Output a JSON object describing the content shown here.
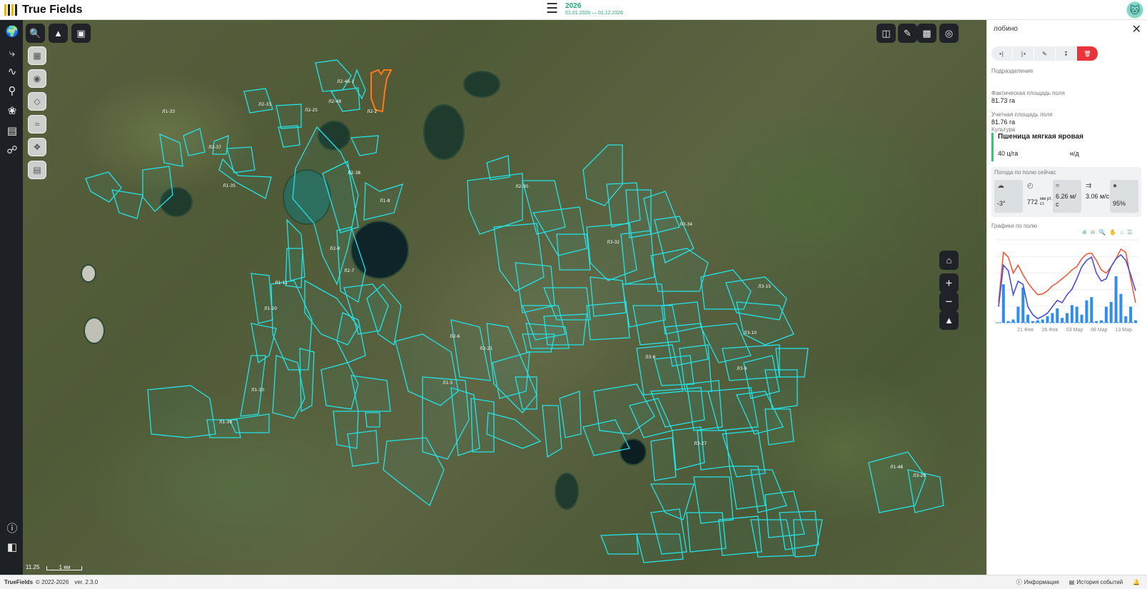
{
  "app": {
    "name": "True Fields",
    "logo_colors": [
      "#f4b400",
      "#222222",
      "#f4b400",
      "#222222"
    ]
  },
  "header": {
    "menu_icon": "hamburger-icon",
    "year": "2026",
    "date_range": "01.01.2026 — 01.12.2026",
    "user_avatar_icon": "cat-avatar-icon"
  },
  "sidebar": {
    "top_items": [
      "globe-leaf-icon",
      "tractor-route-icon",
      "trend-chart-icon",
      "analysis-search-icon",
      "plant-hand-icon",
      "calendar-list-icon",
      "network-icon"
    ],
    "bottom_items": [
      "info-icon",
      "panel-toggle-icon"
    ]
  },
  "map": {
    "toolbar_left": [
      "search-icon",
      "terrain-icon",
      "crop-select-icon"
    ],
    "layer_tools": [
      "map-layers-icon",
      "pin-icon",
      "stack-icon",
      "ruler-tool-icon",
      "shapes-icon",
      "report-icon"
    ],
    "toolbar_right": [
      "compare-icon",
      "measure-icon",
      "hatch-icon",
      "locate-icon"
    ],
    "zoom_controls": [
      "home-icon",
      "zoom-in-icon",
      "zoom-out-icon",
      "north-arrow-icon"
    ],
    "field_color": "#23e3e8",
    "selected_field_color": "#ff7a1a",
    "scale_zoom": "11.25",
    "scale_label": "1 км",
    "field_labels": [
      "Л2-46-1",
      "Л2-48",
      "Л2-25",
      "Л1-33",
      "Л2-37",
      "Л1-35",
      "Л2-33",
      "Л1-11",
      "Л1-8",
      "Л3-32",
      "Л2-30",
      "Л1-20",
      "Л2-38",
      "Л2-2",
      "Л2-7",
      "Л1-5",
      "Л2-21",
      "Л3-8",
      "Л3-27",
      "Л3-10",
      "Л1-48",
      "Л1-39",
      "Л3-9",
      "Л2-8",
      "Л3-15",
      "Л1-10",
      "Л2-6",
      "Л3-34",
      "Л3-29"
    ]
  },
  "panel": {
    "title": "лобино",
    "close_icon": "close-icon",
    "actions": [
      "split-field-icon",
      "merge-field-icon",
      "edit-icon",
      "download-icon",
      "delete-icon"
    ],
    "subdivision_label": "Подразделение",
    "actual_area_label": "Фактическая площадь поля",
    "actual_area_value": "81.73 га",
    "registered_area_label": "Учетная площадь поля",
    "registered_area_value": "81.76 га",
    "crop_label": "Культура",
    "crop_name": "Пшеница мягкая яровая",
    "crop_yield": "40 ц/га",
    "crop_extra": "н/д",
    "weather_title": "Погода по полю сейчас",
    "weather": {
      "temp": "-3°",
      "pressure_value": "772",
      "pressure_unit": "мм рт. ст.",
      "wind_gust": "6.26 м/с",
      "wind": "3.06 м/с",
      "humidity": "95%"
    },
    "charts_title": "Графики по полю",
    "chart_tools": [
      "zoom-in-icon",
      "zoom-out-icon",
      "magnify-icon",
      "pan-icon",
      "home-icon",
      "menu-icon"
    ]
  },
  "chart_data": {
    "type": "line",
    "xlabel": "",
    "ylabel": "",
    "x_ticks": [
      "21 Фев",
      "26 Фев",
      "03 Мар",
      "08 Мар",
      "13 Мар"
    ],
    "series": [
      {
        "color": "#ef5a3c",
        "values": [
          0.25,
          0.88,
          0.82,
          0.62,
          0.72,
          0.6,
          0.5,
          0.42,
          0.35,
          0.36,
          0.4,
          0.46,
          0.5,
          0.55,
          0.6,
          0.66,
          0.7,
          0.8,
          0.86,
          0.87,
          0.78,
          0.66,
          0.62,
          0.7,
          0.8,
          0.92,
          0.88,
          0.55,
          0.25
        ]
      },
      {
        "color": "#4b4fd6",
        "values": [
          0.2,
          0.72,
          0.65,
          0.35,
          0.52,
          0.48,
          0.2,
          0.1,
          0.05,
          0.08,
          0.12,
          0.2,
          0.28,
          0.25,
          0.35,
          0.42,
          0.55,
          0.7,
          0.78,
          0.82,
          0.62,
          0.52,
          0.55,
          0.7,
          0.8,
          0.85,
          0.78,
          0.6,
          0.4
        ]
      },
      {
        "color": "#2f8cf0",
        "values": [
          0,
          0.48,
          0.02,
          0.04,
          0.2,
          0.44,
          0.1,
          0.02,
          0.03,
          0.04,
          0.08,
          0.12,
          0.18,
          0.06,
          0.12,
          0.22,
          0.2,
          0.1,
          0.28,
          0.32,
          0.02,
          0.03,
          0.2,
          0.26,
          0.58,
          0.36,
          0.08,
          0.2,
          0.03
        ]
      }
    ]
  }
}
